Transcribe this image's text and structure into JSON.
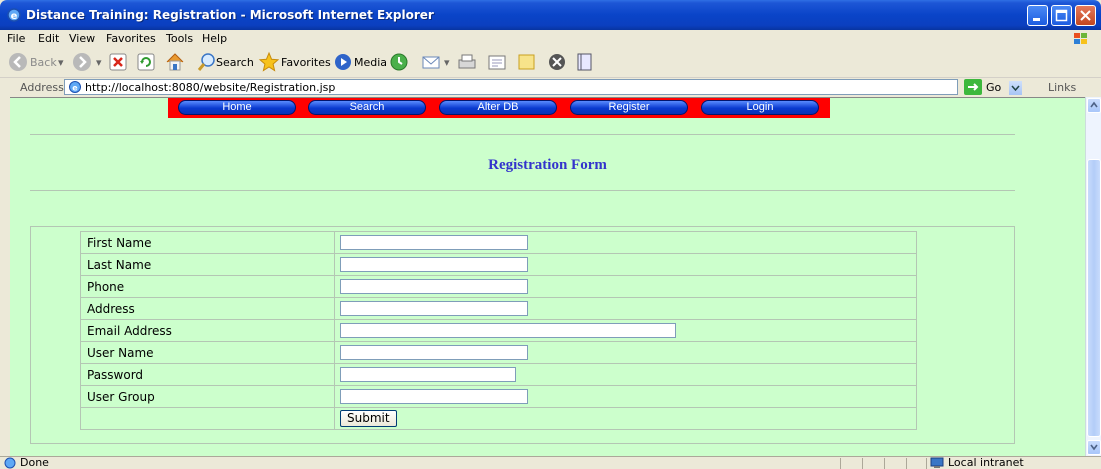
{
  "window": {
    "title": "Distance Training: Registration - Microsoft Internet Explorer"
  },
  "menu": [
    "File",
    "Edit",
    "View",
    "Favorites",
    "Tools",
    "Help"
  ],
  "toolbar": {
    "back": "Back",
    "search": "Search",
    "favorites": "Favorites",
    "media": "Media"
  },
  "address": {
    "label": "Address",
    "url": "http://localhost:8080/website/Registration.jsp",
    "go": "Go",
    "links": "Links"
  },
  "nav": [
    "Home",
    "Search",
    "Alter DB",
    "Register",
    "Login"
  ],
  "page": {
    "title": "Registration Form"
  },
  "form": {
    "fields": [
      {
        "label": "First Name",
        "value": ""
      },
      {
        "label": "Last Name",
        "value": ""
      },
      {
        "label": "Phone",
        "value": ""
      },
      {
        "label": "Address",
        "value": ""
      },
      {
        "label": "Email Address",
        "value": ""
      },
      {
        "label": "User Name",
        "value": ""
      },
      {
        "label": "Password",
        "value": ""
      },
      {
        "label": "User Group",
        "value": ""
      }
    ],
    "submit": "Submit"
  },
  "status": {
    "text": "Done",
    "zone": "Local intranet"
  }
}
